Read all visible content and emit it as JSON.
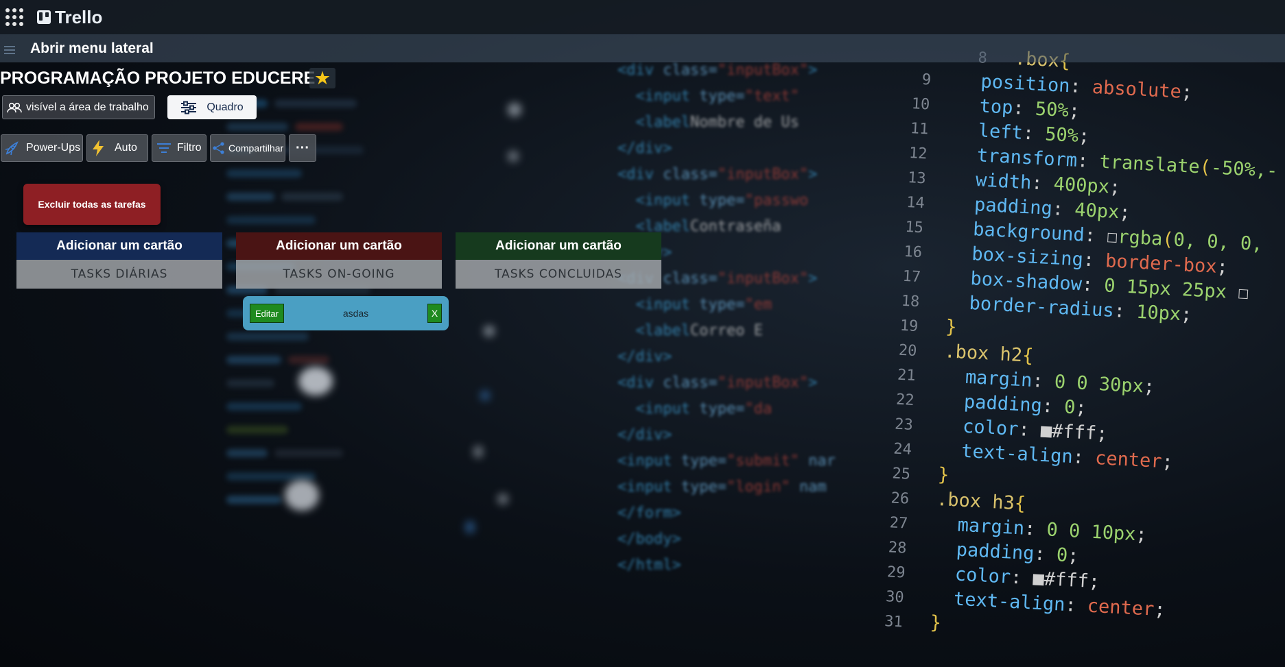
{
  "app": {
    "logo_text": "Trello"
  },
  "topbar": {
    "apps_icon": "grid-dots-icon"
  },
  "sidebar_toggle": {
    "label": "Abrir menu lateral",
    "icon": "hamburger-icon"
  },
  "board": {
    "title": "PROGRAMAÇÃO PROJETO EDUCERE",
    "star_icon": "star-icon",
    "star_color": "#f5c518",
    "visibility_label": "visível a área de trabalho",
    "view_label": "Quadro"
  },
  "toolbar": {
    "powerups_label": "Power-Ups",
    "automation_label": "Auto",
    "filter_label": "Filtro",
    "share_label": "Compartilhar",
    "more_label": "···"
  },
  "delete_all": {
    "label": "Excluir todas as tarefas",
    "color": "#8e1f24"
  },
  "lists": [
    {
      "header": "Adicionar um cartão",
      "name": "TASKS DIÁRIAS",
      "header_color": "#142a55"
    },
    {
      "header": "Adicionar um cartão",
      "name": "TASKS ON-GOING",
      "header_color": "#4a1414"
    },
    {
      "header": "Adicionar um cartão",
      "name": "TASKS CONCLUIDAS",
      "header_color": "#163a1e"
    }
  ],
  "cards": [
    {
      "list": "TASKS ON-GOING",
      "edit_label": "Editar",
      "text": "asdas",
      "delete_label": "X"
    }
  ]
}
